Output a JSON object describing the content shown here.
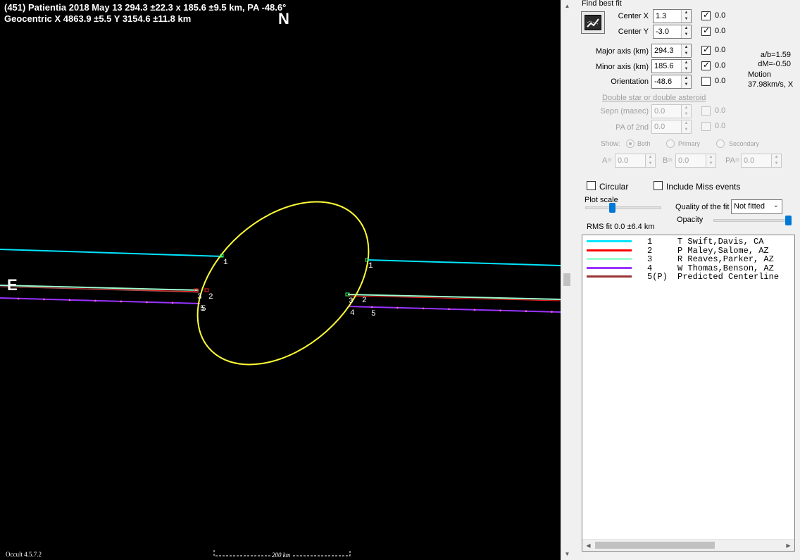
{
  "plot": {
    "header_line1": "(451) Patientia  2018 May 13  294.3 ±22.3 x 185.6 ±9.5 km, PA -48.6°",
    "header_line2": "Geocentric  X  4863.9 ±5.5  Y 3154.6 ±11.8 km",
    "north_label": "N",
    "east_label": "E",
    "version": "Occult 4.5.7.2",
    "scale_label": "200 km",
    "chord_labels": {
      "w1": "1",
      "w2": "2",
      "w3": "3",
      "w4": "5",
      "w5": "5",
      "e1": "1",
      "e2": "2",
      "e3": "3",
      "e4": "4",
      "e5": "5"
    },
    "colors": {
      "background": "#000000",
      "ellipse": "#ffff33",
      "chord1": "#00e5ff",
      "chord2": "#ff2020",
      "chord3": "#9fffd0",
      "chord4": "#9933ff",
      "chord5": "#a05050"
    }
  },
  "panel": {
    "find_best_fit_label": "Find best fit",
    "center_x": {
      "label": "Center X",
      "value": "1.3",
      "check": "0.0",
      "checked": true
    },
    "center_y": {
      "label": "Center Y",
      "value": "-3.0",
      "check": "0.0",
      "checked": true
    },
    "major_axis": {
      "label": "Major axis (km)",
      "value": "294.3",
      "check": "0.0",
      "checked": true
    },
    "minor_axis": {
      "label": "Minor axis (km)",
      "value": "185.6",
      "check": "0.0",
      "checked": true
    },
    "orientation": {
      "label": "Orientation",
      "value": "-48.6",
      "check": "0.0",
      "checked": false
    },
    "ratio": "a/b=1.59",
    "dm": "dM=-0.50",
    "motion_label": "Motion",
    "motion_value": "37.98km/s, X",
    "double_star_label": "Double star  or  double asteroid",
    "sepn": {
      "label": "Sepn (masec)",
      "value": "0.0",
      "check": "0.0"
    },
    "pa2nd": {
      "label": "PA of 2nd",
      "value": "0.0",
      "check": "0.0"
    },
    "show_label": "Show:",
    "show_options": [
      "Both",
      "Primary",
      "Secondary"
    ],
    "a_label": "A=",
    "a_value": "0.0",
    "b_label": "B=",
    "b_value": "0.0",
    "pa_label": "PA=",
    "pa_value": "0.0",
    "circular_label": "Circular",
    "include_miss_label": "Include Miss events",
    "plot_scale_label": "Plot scale",
    "quality_label": "Quality of the fit",
    "quality_value": "Not fitted",
    "opacity_label": "Opacity",
    "opacity_level": 1.0,
    "plot_scale_level": 0.35,
    "rms_label": "RMS fit  0.0 ±6.4 km"
  },
  "legend": [
    {
      "num": "1   ",
      "name": "T Swift,Davis, CA",
      "color": "#00e5ff"
    },
    {
      "num": "2   ",
      "name": "P Maley,Salome, AZ",
      "color": "#ff0000"
    },
    {
      "num": "3   ",
      "name": "R Reaves,Parker, AZ",
      "color": "#99ffd0"
    },
    {
      "num": "4   ",
      "name": "W Thomas,Benson, AZ",
      "color": "#9933ff"
    },
    {
      "num": "5(P)",
      "name": "Predicted Centerline",
      "color": "#993333"
    }
  ]
}
